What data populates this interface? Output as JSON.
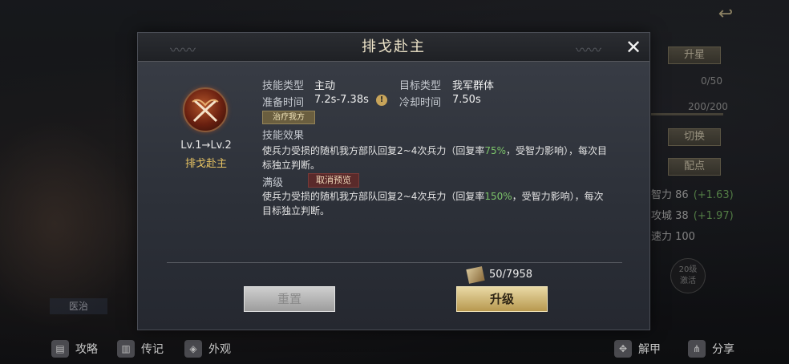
{
  "dialog": {
    "title": "排戈赴主",
    "close_symbol": "✕"
  },
  "skill": {
    "level_text": "Lv.1→Lv.2",
    "name": "排戈赴主",
    "icon": "crossed-blades-icon"
  },
  "stats": {
    "type_label": "技能类型",
    "type_value": "主动",
    "target_label": "目标类型",
    "target_value": "我军群体",
    "prep_label": "准备时间",
    "prep_value": "7.2s-7.38s",
    "cooldown_label": "冷却时间",
    "cooldown_value": "7.50s",
    "info_symbol": "!",
    "tag": "治疗我方"
  },
  "effect": {
    "label": "技能效果",
    "line1_a": "使兵力受损的随机我方部队回复2~4次兵力（回复率",
    "line1_pct": "75%",
    "line1_b": "，受智力影响），每次目",
    "line2": "标独立判断。"
  },
  "max_level": {
    "label": "满级",
    "cancel_preview": "取消预览",
    "line1_a": "使兵力受损的随机我方部队回复2~4次兵力（回复率",
    "line1_pct": "150%",
    "line1_b": "，受智力影响），每次",
    "line2": "目标独立判断。"
  },
  "cost": {
    "text": "50/7958",
    "icon": "scroll-icon"
  },
  "buttons": {
    "reset": "重置",
    "upgrade": "升级"
  },
  "side_panel": {
    "upgrade_star": "升星",
    "progress1": "0/50",
    "progress2": "200/200",
    "progress2_fraction": 1.0,
    "switch": "切换",
    "assign_points": "配点",
    "stat1_name": "智力 86",
    "stat1_plus": "(+1.63)",
    "stat2_name": "攻城 38",
    "stat2_plus": "(+1.97)",
    "stat3_name": "速力 100",
    "unlock_badge": "20级\n激活"
  },
  "left_label": "医治",
  "bottom_nav": {
    "guide": "攻略",
    "biography": "传记",
    "appearance": "外观",
    "unarmor": "解甲",
    "share": "分享"
  },
  "colors": {
    "accent_gold": "#e8c463",
    "green": "#7cc46a",
    "button_gold": "#e9d9a5"
  }
}
